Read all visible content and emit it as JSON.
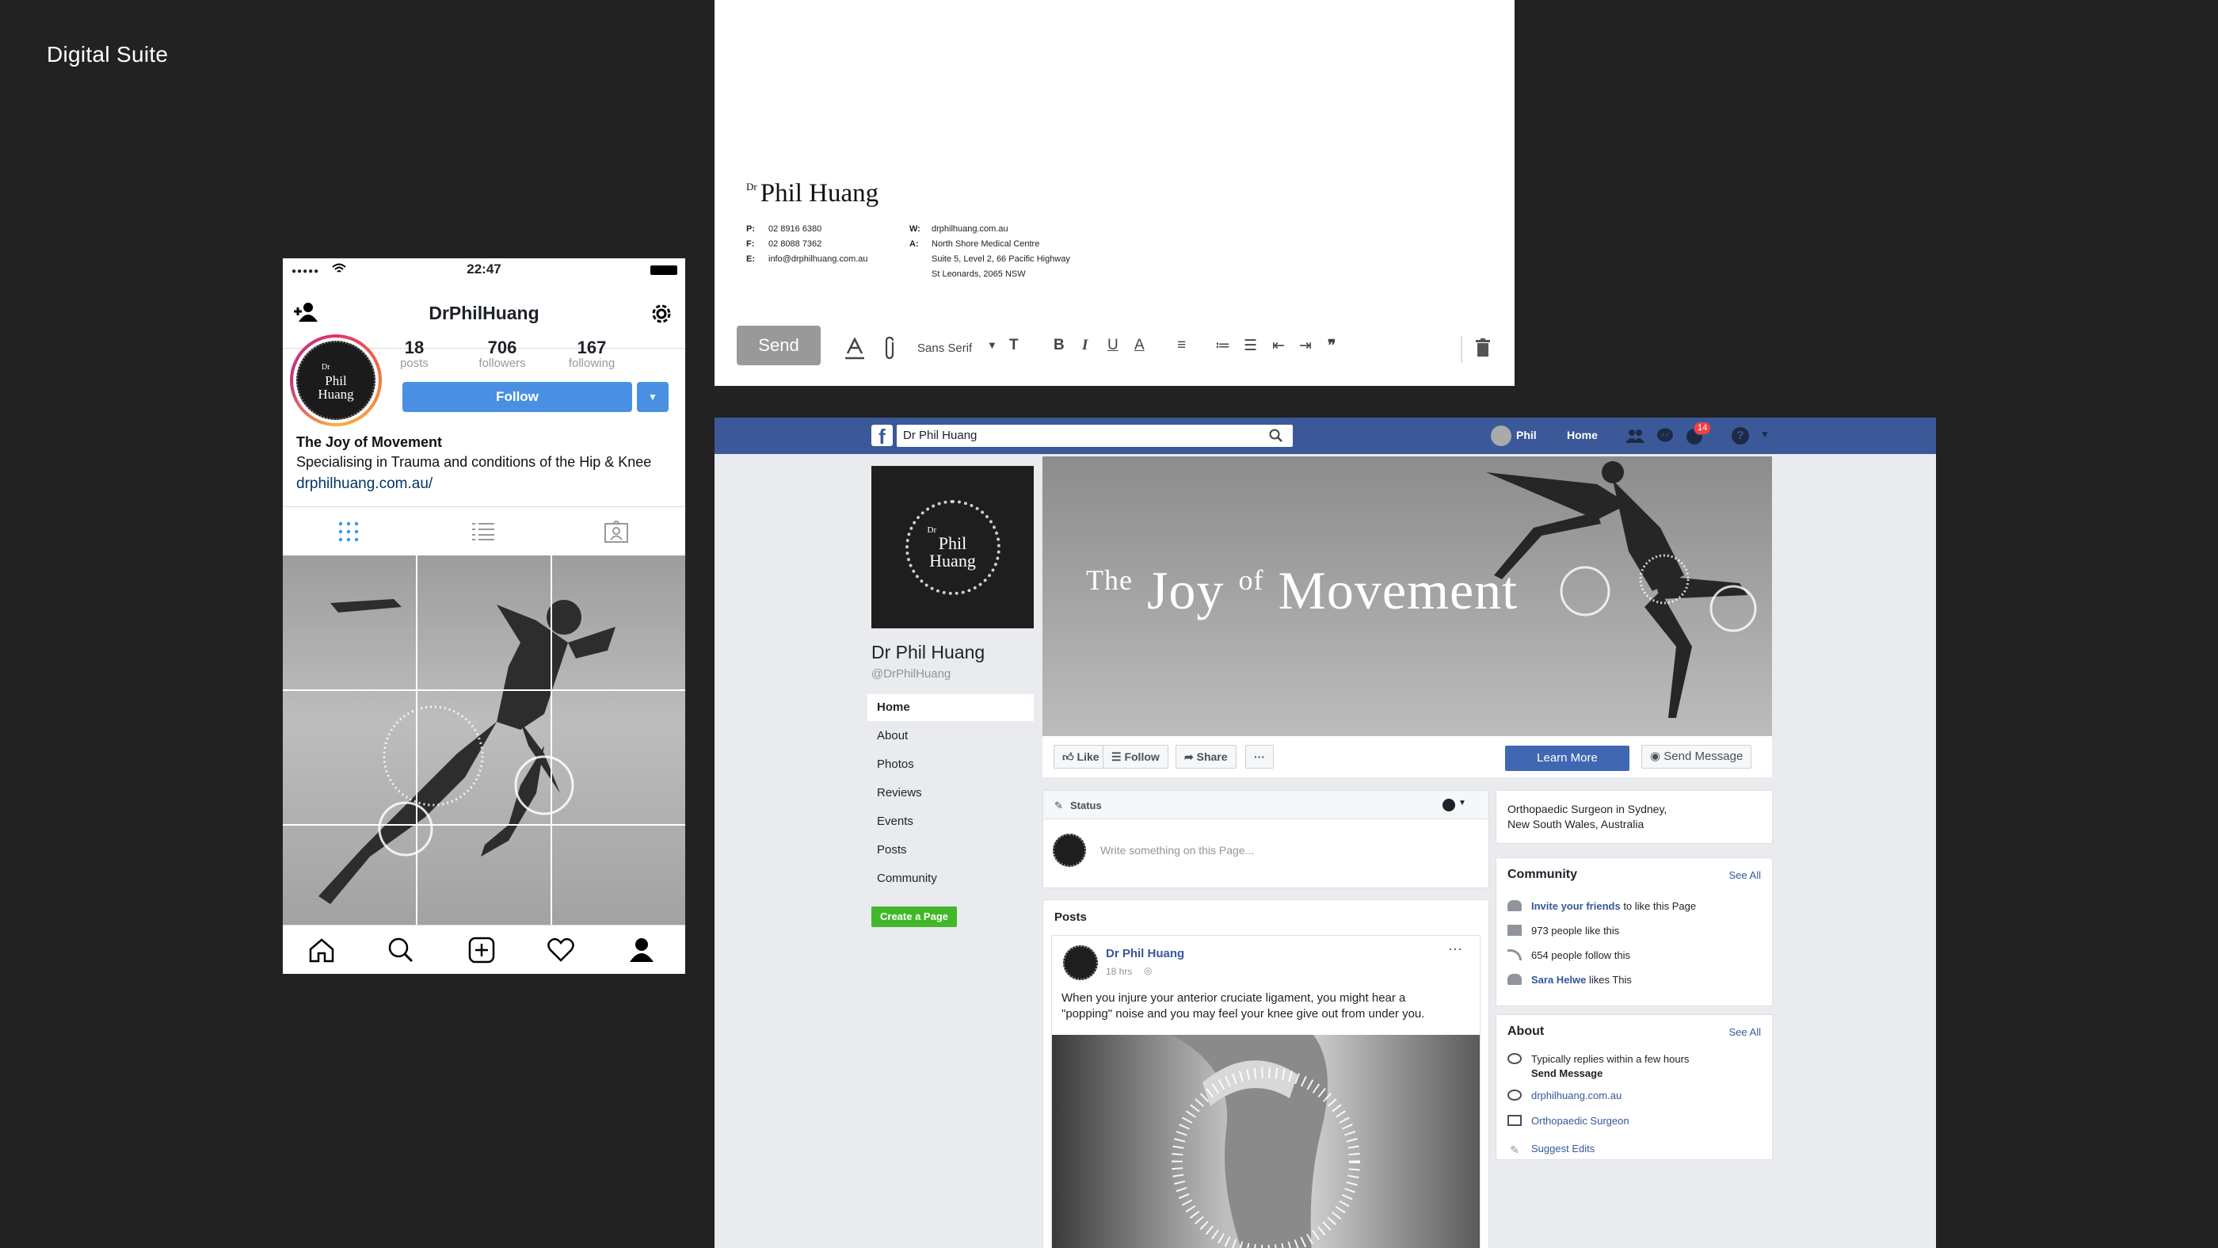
{
  "page": {
    "title": "Digital Suite"
  },
  "instagram": {
    "status_time": "22:47",
    "username": "DrPhilHuang",
    "avatar_text": [
      "Dr",
      "Phil",
      "Huang"
    ],
    "stats": [
      {
        "value": "18",
        "label": "posts"
      },
      {
        "value": "706",
        "label": "followers"
      },
      {
        "value": "167",
        "label": "following"
      }
    ],
    "follow_label": "Follow",
    "bio": {
      "name": "The Joy of Movement",
      "line": "Specialising in Trauma and conditions of the Hip & Knee",
      "link": "drphilhuang.com.au/"
    },
    "tabs": [
      "grid-icon",
      "list-icon",
      "tagged-icon"
    ],
    "nav": [
      "home-icon",
      "search-icon",
      "add-icon",
      "heart-icon",
      "profile-icon"
    ]
  },
  "email": {
    "signature": {
      "prefix": "Dr",
      "name": "Phil Huang",
      "phone_label": "P:",
      "phone": "02 8916 6380",
      "fax_label": "F:",
      "fax": "02 8088 7362",
      "email_label": "E:",
      "email": "info@drphilhuang.com.au",
      "web_label": "W:",
      "web": "drphilhuang.com.au",
      "address_label": "A:",
      "address": [
        "North Shore Medical Centre",
        "Suite 5, Level 2, 66 Pacific Highway",
        "St Leonards, 2065 NSW"
      ]
    },
    "toolbar": {
      "send_label": "Send",
      "font_label": "Sans Serif"
    }
  },
  "facebook": {
    "search_value": "Dr Phil Huang",
    "top_nav": {
      "user": "Phil",
      "home": "Home",
      "notification_count": "14"
    },
    "profile_pic_text": [
      "Dr",
      "Phil",
      "Huang"
    ],
    "page_name": "Dr Phil Huang",
    "handle": "@DrPhilHuang",
    "sidebar": [
      "Home",
      "About",
      "Photos",
      "Reviews",
      "Events",
      "Posts",
      "Community"
    ],
    "create_page": "Create a Page",
    "cover": {
      "the": "The",
      "joy": "Joy",
      "of": "of",
      "movement": "Movement"
    },
    "actions": {
      "like": "Like",
      "follow": "Follow",
      "share": "Share",
      "more": "···",
      "learn_more": "Learn More",
      "send_message": "Send Message"
    },
    "composer": {
      "status_label": "Status",
      "placeholder": "Write something on this Page..."
    },
    "posts": {
      "heading": "Posts",
      "author": "Dr Phil Huang",
      "time": "18 hrs",
      "text_line1": "When you injure your anterior cruciate ligament, you might hear a",
      "text_line2": "\"popping\" noise and you may feel your knee give out from under you."
    },
    "info": {
      "line1": "Orthopaedic Surgeon in Sydney,",
      "line2": "New South Wales, Australia"
    },
    "community": {
      "heading": "Community",
      "see_all": "See All",
      "invite_link": "Invite your friends",
      "invite_rest": " to like this Page",
      "likes": "973 people like this",
      "follows": "654 people follow this",
      "friend_link": "Sara Helwe",
      "friend_rest": " likes This"
    },
    "about": {
      "heading": "About",
      "see_all": "See All",
      "replies": "Typically replies within a few hours",
      "send_message": "Send Message",
      "website": "drphilhuang.com.au",
      "category": "Orthopaedic Surgeon",
      "suggest": "Suggest Edits"
    },
    "colors": {
      "brand": "#3b5998",
      "button": "#4267b2",
      "green": "#42b72a"
    }
  }
}
